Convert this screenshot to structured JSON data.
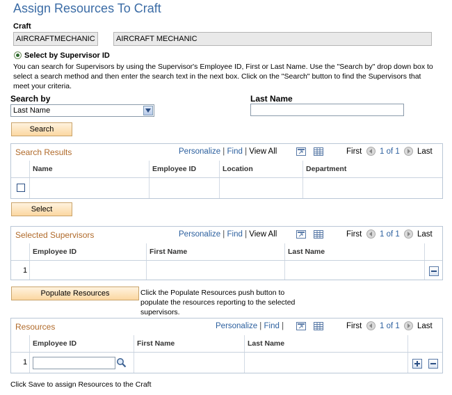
{
  "page": {
    "title": "Assign Resources To Craft",
    "footer_text": "Click Save to assign Resources to the Craft"
  },
  "craft": {
    "label": "Craft",
    "code": "AIRCRAFTMECHANIC",
    "description": "AIRCRAFT MECHANIC"
  },
  "supervisor_search": {
    "radio_label": "Select by Supervisor ID",
    "instructions": "You can search for Supervisors by using the Supervisor's Employee ID, First or Last Name. Use the \"Search by\" drop down box to select a search method and then enter the search text in the next box. Click on the \"Search\" button to find the Supervisors that meet your criteria.",
    "search_by_label": "Search by",
    "search_by_value": "Last Name",
    "last_name_label": "Last Name",
    "last_name_value": "",
    "search_button": "Search"
  },
  "grid_nav": {
    "personalize": "Personalize",
    "find": "Find",
    "sep": "|",
    "view_all": "View All",
    "first": "First",
    "range": "1 of 1",
    "last": "Last"
  },
  "search_results": {
    "title": "Search Results",
    "columns": [
      "Name",
      "Employee ID",
      "Location",
      "Department"
    ],
    "select_button": "Select"
  },
  "selected_supervisors": {
    "title": "Selected Supervisors",
    "columns": [
      "Employee ID",
      "First Name",
      "Last Name"
    ],
    "row_number": "1",
    "populate_button": "Populate Resources",
    "populate_help": "Click the Populate Resources push button to populate the resources reporting to the selected supervisors."
  },
  "resources": {
    "title": "Resources",
    "columns": [
      "Employee ID",
      "First Name",
      "Last Name"
    ],
    "row_number": "1"
  },
  "colors": {
    "title_blue": "#3a6ba5",
    "grid_title_orange": "#b06a2a",
    "link_blue": "#2b5f9e",
    "button_fill": "#fbd7a1"
  },
  "icons": [
    "radio-selected-icon",
    "dropdown-arrow-icon",
    "checkbox-icon",
    "zoom-icon",
    "download-icon",
    "prev-arrow-icon",
    "next-arrow-icon",
    "add-row-icon",
    "delete-row-icon",
    "lookup-icon"
  ]
}
